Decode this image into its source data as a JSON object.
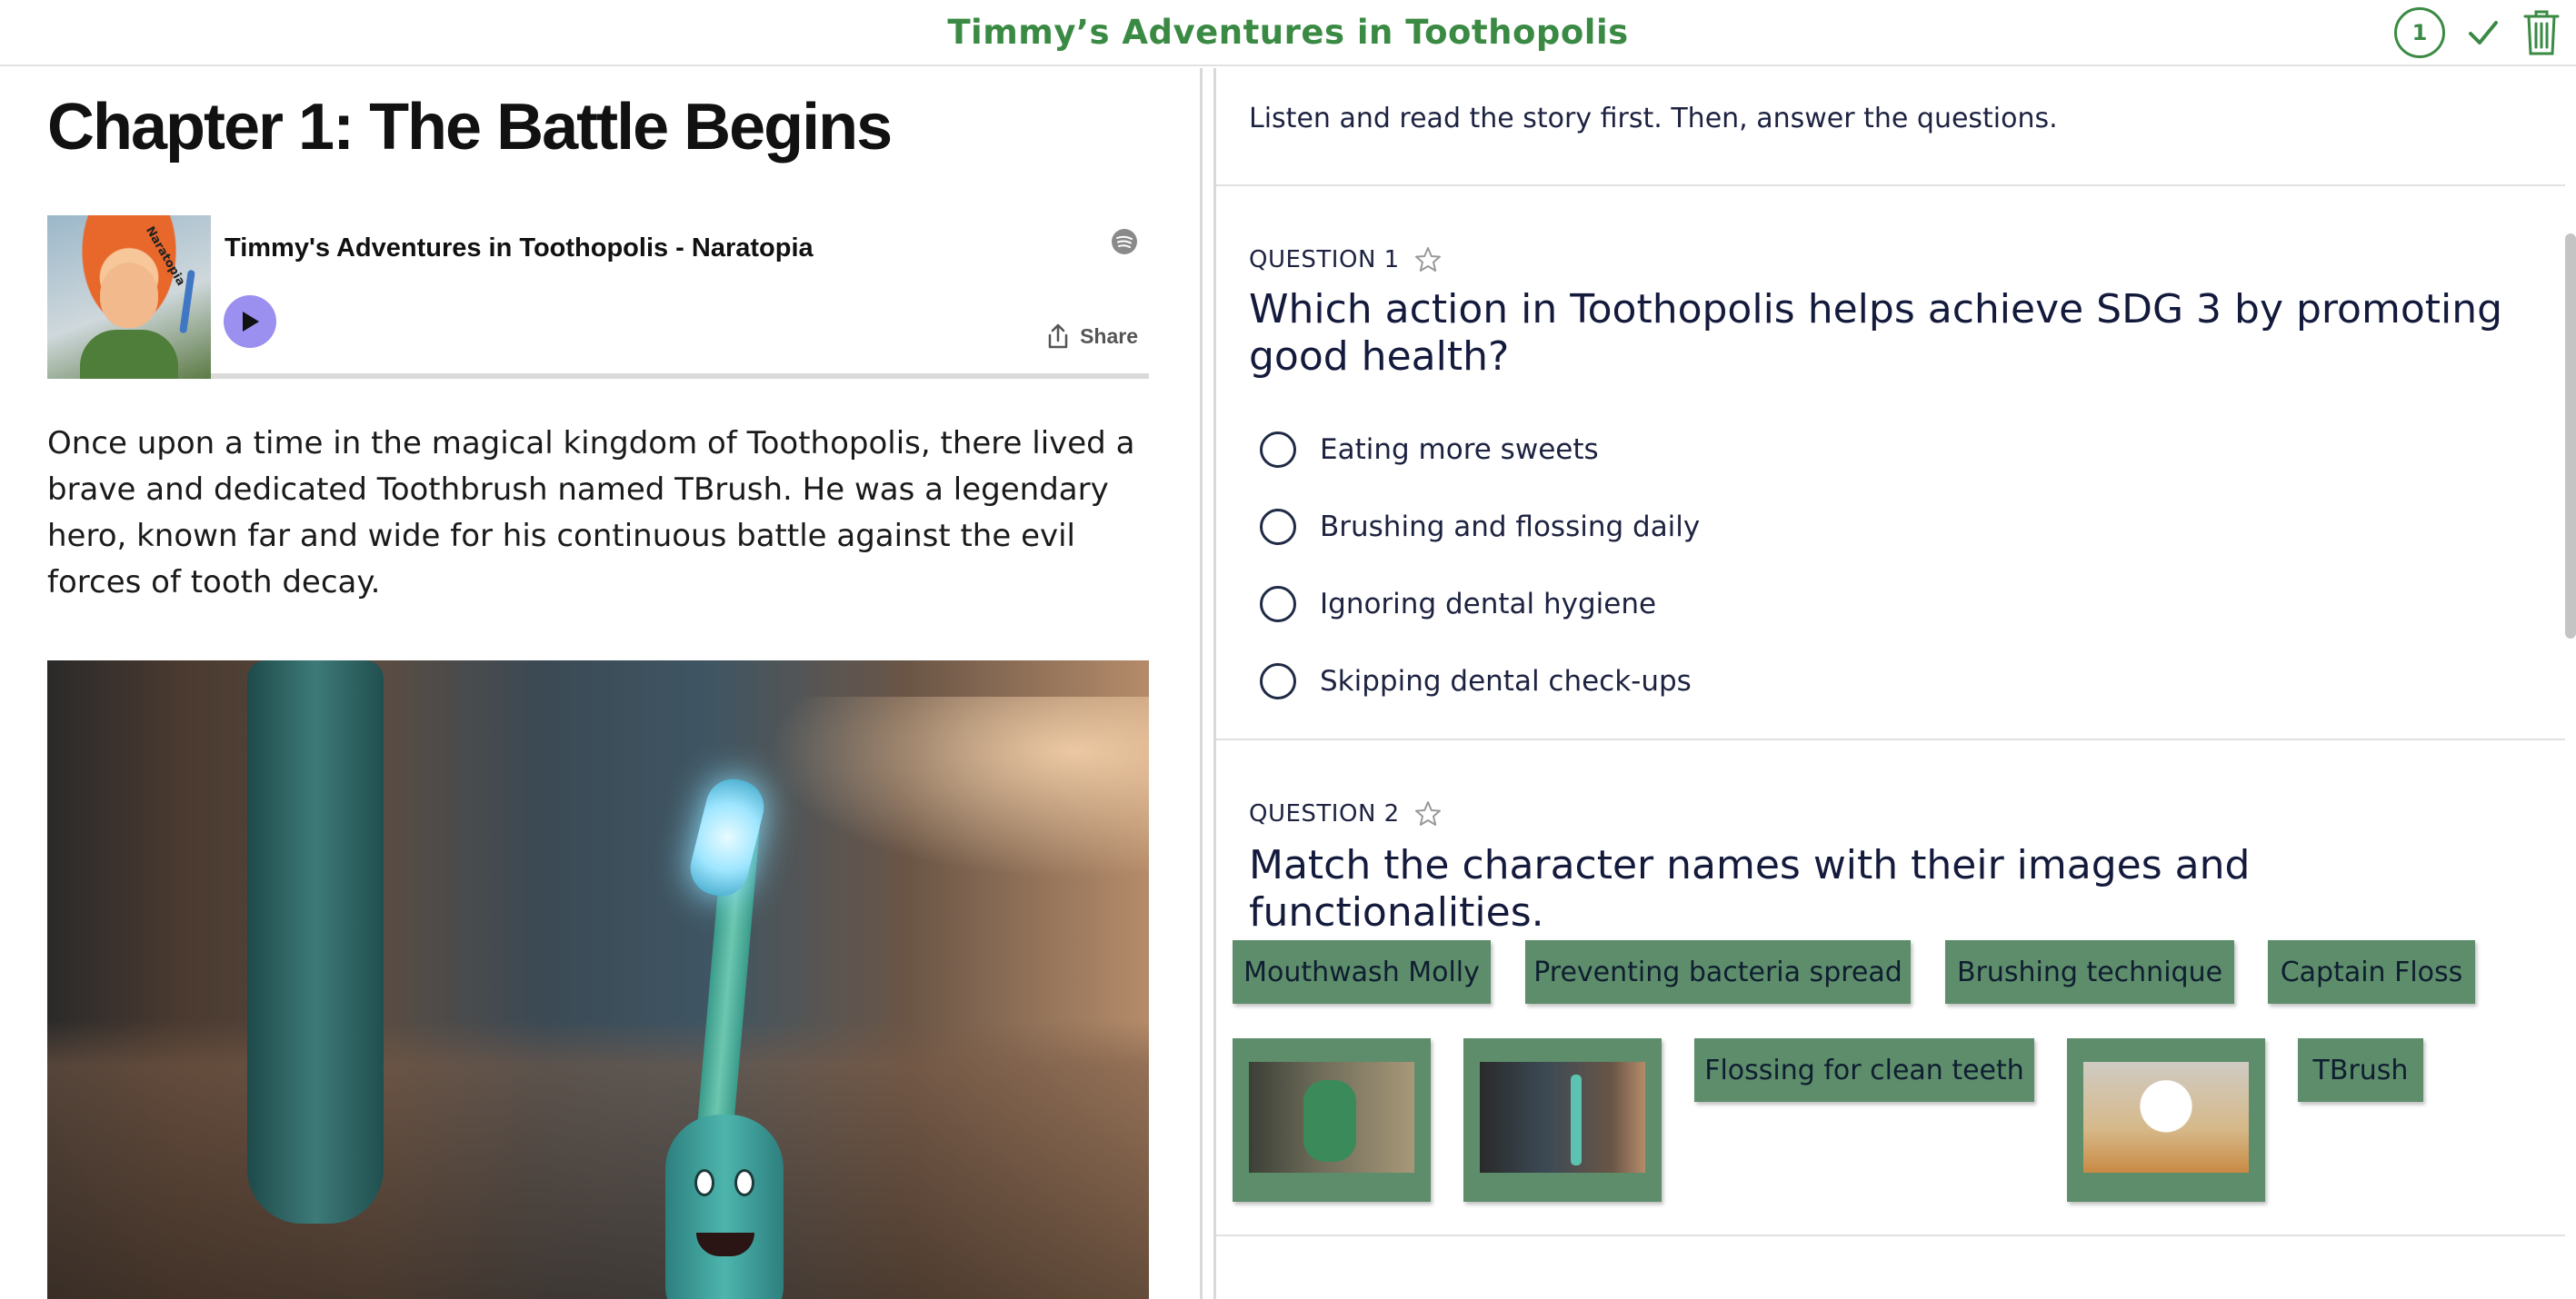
{
  "header": {
    "title": "Timmy’s Adventures in Toothopolis",
    "question_count": "1"
  },
  "left": {
    "chapter_title": "Chapter 1: The Battle Begins",
    "player": {
      "track_title": "Timmy's Adventures in Toothopolis - Naratopia",
      "cover_brand": "Naratopia",
      "share_label": "Share",
      "progress": 0
    },
    "story_text": "Once upon a time in the magical kingdom of Toothopolis, there lived a brave and dedicated Toothbrush named TBrush. He was a legendary hero, known far and wide for his continuous battle against the evil forces of tooth decay."
  },
  "right": {
    "instructions": "Listen and read the story first. Then, answer the questions.",
    "question1": {
      "label": "QUESTION 1",
      "text": "Which action in Toothopolis helps achieve SDG 3 by promoting good health?",
      "options": [
        "Eating more sweets",
        "Brushing and flossing daily",
        "Ignoring dental hygiene",
        "Skipping dental check-ups"
      ]
    },
    "question2": {
      "label": "QUESTION 2",
      "text": "Match the character names with their images and functionalities.",
      "tiles": {
        "mouthwash_molly": "Mouthwash Molly",
        "preventing_bacteria": "Preventing bacteria spread",
        "brushing_technique": "Brushing technique",
        "captain_floss": "Captain Floss",
        "flossing": "Flossing for clean teeth",
        "tbrush": "TBrush"
      }
    }
  },
  "colors": {
    "brand_green": "#3a8a44",
    "tile_green": "#5d8d6a",
    "play_purple": "#9b8ff0",
    "question_text": "#141a3c"
  },
  "icons": [
    "check-icon",
    "trash-icon",
    "spotify-icon",
    "play-icon",
    "share-icon",
    "star-icon"
  ]
}
